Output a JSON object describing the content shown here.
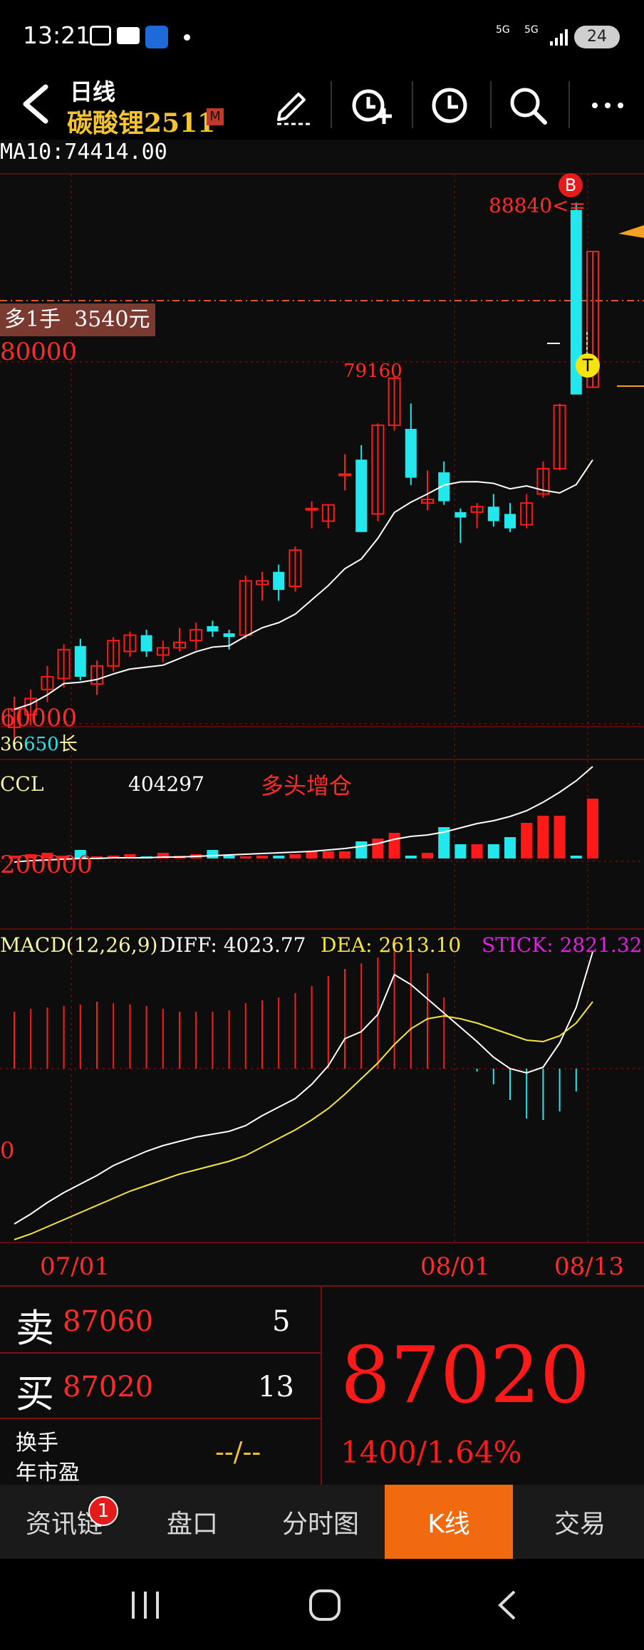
{
  "status": {
    "time": "13:21",
    "battery": "24",
    "net1": "5G",
    "net2": "5G"
  },
  "header": {
    "period": "日线",
    "symbol": "碳酸锂2511",
    "badge": "M"
  },
  "indicators": {
    "ma_label": "MA10:74414.00",
    "position_label": "多1手  3540元",
    "high_mark": "88840",
    "high_mark_suffix": "<=",
    "buy_marker": "B",
    "t_marker": "T",
    "peak_label": "79160",
    "price_80000": "80000",
    "price_60000": "60000",
    "low_label_a": "36",
    "low_label_b": "650",
    "low_label_c": "长"
  },
  "ccl": {
    "label": "CCL",
    "value": "404297",
    "signal": "多头增仓",
    "axis": "200000"
  },
  "macd": {
    "label": "MACD(12,26,9)",
    "diff": "DIFF: 4023.77",
    "dea": "DEA: 2613.10",
    "stick": "STICK: 2821.32",
    "zero": "0"
  },
  "dates": [
    "07/01",
    "08/01",
    "08/13"
  ],
  "quote": {
    "sell_label": "卖",
    "sell_price": "87060",
    "sell_vol": "5",
    "buy_label": "买",
    "buy_price": "87020",
    "buy_vol": "13",
    "turnover_label": "换手",
    "pe_label": "年市盈",
    "pe_value": "--/--",
    "last_price": "87020",
    "change": "1400/1.64%"
  },
  "tabs": [
    {
      "label": "资讯链",
      "badge": "1"
    },
    {
      "label": "盘口"
    },
    {
      "label": "分时图"
    },
    {
      "label": "K线",
      "active": true
    },
    {
      "label": "交易"
    }
  ],
  "colors": {
    "up": "#ff1a1a",
    "down": "#22e8ee",
    "accent": "#f26a10",
    "gold": "#f4c430",
    "magenta": "#e020e0"
  },
  "chart_data": {
    "type": "candlestick",
    "ylim": [
      58000,
      90000
    ],
    "candles": [
      {
        "o": 59800,
        "h": 61500,
        "l": 59200,
        "c": 60800
      },
      {
        "o": 60500,
        "h": 61900,
        "l": 59900,
        "c": 61400
      },
      {
        "o": 61900,
        "h": 63200,
        "l": 61200,
        "c": 62600
      },
      {
        "o": 62500,
        "h": 64400,
        "l": 62000,
        "c": 64100
      },
      {
        "o": 64300,
        "h": 64700,
        "l": 62400,
        "c": 62600
      },
      {
        "o": 62200,
        "h": 63500,
        "l": 61600,
        "c": 63200
      },
      {
        "o": 63200,
        "h": 64800,
        "l": 62900,
        "c": 64600
      },
      {
        "o": 64000,
        "h": 65100,
        "l": 63700,
        "c": 64900
      },
      {
        "o": 64900,
        "h": 65200,
        "l": 63700,
        "c": 64000
      },
      {
        "o": 63800,
        "h": 64600,
        "l": 63400,
        "c": 64200
      },
      {
        "o": 64200,
        "h": 65300,
        "l": 64000,
        "c": 64500
      },
      {
        "o": 64600,
        "h": 65600,
        "l": 64100,
        "c": 65200
      },
      {
        "o": 65400,
        "h": 65700,
        "l": 64800,
        "c": 65100
      },
      {
        "o": 65000,
        "h": 65200,
        "l": 64100,
        "c": 64800
      },
      {
        "o": 64900,
        "h": 68200,
        "l": 64700,
        "c": 67900
      },
      {
        "o": 67700,
        "h": 68400,
        "l": 66800,
        "c": 67900
      },
      {
        "o": 68400,
        "h": 68800,
        "l": 66800,
        "c": 67400
      },
      {
        "o": 67600,
        "h": 69800,
        "l": 67300,
        "c": 69600
      },
      {
        "o": 71900,
        "h": 72300,
        "l": 70800,
        "c": 71900
      },
      {
        "o": 71200,
        "h": 72100,
        "l": 70800,
        "c": 72100
      },
      {
        "o": 73800,
        "h": 74900,
        "l": 72900,
        "c": 73800
      },
      {
        "o": 74600,
        "h": 75400,
        "l": 70600,
        "c": 70600
      },
      {
        "o": 71600,
        "h": 76600,
        "l": 71200,
        "c": 76500
      },
      {
        "o": 76500,
        "h": 79200,
        "l": 76200,
        "c": 79100
      },
      {
        "o": 76300,
        "h": 77700,
        "l": 73200,
        "c": 73600
      },
      {
        "o": 72200,
        "h": 74000,
        "l": 71800,
        "c": 72400
      },
      {
        "o": 73900,
        "h": 74500,
        "l": 72100,
        "c": 72300
      },
      {
        "o": 71700,
        "h": 71900,
        "l": 70000,
        "c": 71400
      },
      {
        "o": 71700,
        "h": 72200,
        "l": 70800,
        "c": 72000
      },
      {
        "o": 72000,
        "h": 72700,
        "l": 70900,
        "c": 71200
      },
      {
        "o": 71600,
        "h": 72200,
        "l": 70600,
        "c": 70800
      },
      {
        "o": 71000,
        "h": 72700,
        "l": 70800,
        "c": 72200
      },
      {
        "o": 72700,
        "h": 74500,
        "l": 72500,
        "c": 74100
      },
      {
        "o": 74100,
        "h": 77700,
        "l": 74000,
        "c": 77600
      },
      {
        "o": 88400,
        "h": 88800,
        "l": 78200,
        "c": 78200
      },
      {
        "o": 78600,
        "h": 86100,
        "l": 78600,
        "c": 86100
      }
    ]
  }
}
